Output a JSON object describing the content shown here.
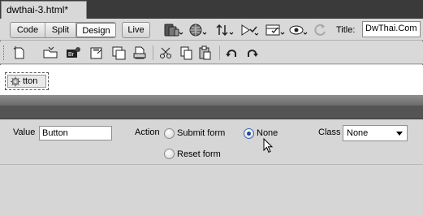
{
  "document_tab": {
    "label": "dwthai-3.html*"
  },
  "doc_toolbar": {
    "views": [
      "Code",
      "Split",
      "Design"
    ],
    "live_label": "Live",
    "title_label": "Title:",
    "title_value": "DwThai.Com",
    "icons": [
      "multiscreen-icon",
      "preview-globe-icon",
      "file-management-icon",
      "check-browser-icon",
      "visual-aids-icon",
      "view-options-icon",
      "refresh-icon"
    ]
  },
  "edit_toolbar": {
    "icons": [
      "new-document-icon",
      "open-icon",
      "bridge-icon",
      "save-icon",
      "save-all-icon",
      "print-code-icon",
      "cut-icon",
      "copy-icon",
      "paste-icon",
      "undo-icon",
      "redo-icon"
    ]
  },
  "design_view": {
    "button_label": "tton"
  },
  "properties": {
    "value_label": "Value",
    "value_input": "Button",
    "action_label": "Action",
    "action_options": [
      "Submit form",
      "None",
      "Reset form"
    ],
    "action_selected": "None",
    "class_label": "Class",
    "class_value": "None"
  }
}
